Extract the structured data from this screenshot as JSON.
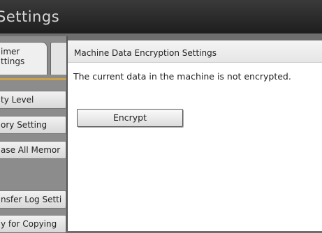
{
  "header": {
    "title": "Settings"
  },
  "tabs": [
    {
      "label_line1": "imer",
      "label_line2": "ttings"
    }
  ],
  "menu": {
    "items": [
      {
        "label": "ty Level"
      },
      {
        "label": "ory Setting"
      },
      {
        "label": "ase All Memor"
      },
      {
        "label": "nsfer Log Setti"
      },
      {
        "label": "y for Copying"
      }
    ]
  },
  "panel": {
    "title": "Machine Data Encryption Settings",
    "message": "The current data in the machine is not encrypted.",
    "encrypt_button": "Encrypt"
  }
}
